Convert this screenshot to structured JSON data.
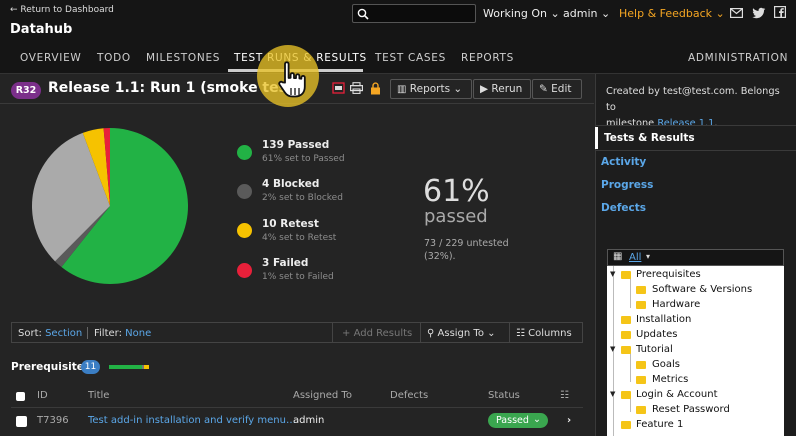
{
  "header": {
    "back_label": "← Return to Dashboard",
    "project": "Datahub",
    "working_on": "Working On",
    "user": "admin",
    "help": "Help & Feedback"
  },
  "tabs": [
    "OVERVIEW",
    "TODO",
    "MILESTONES",
    "TEST RUNS & RESULTS",
    "TEST CASES",
    "REPORTS",
    "ADMINISTRATION"
  ],
  "run": {
    "badge": "R32",
    "title": "Release 1.1: Run 1 (smoke test)",
    "reports_label": "Reports",
    "rerun_label": "Rerun",
    "edit_label": "Edit"
  },
  "legend": [
    {
      "title": "139 Passed",
      "sub": "61% set to Passed",
      "color": "#22b245"
    },
    {
      "title": "4 Blocked",
      "sub": "2% set to Blocked",
      "color": "#5a5a5a"
    },
    {
      "title": "10 Retest",
      "sub": "4% set to Retest",
      "color": "#f6c200"
    },
    {
      "title": "3 Failed",
      "sub": "1% set to Failed",
      "color": "#e8203a"
    }
  ],
  "summary": {
    "percent": "61%",
    "passed_label": "passed",
    "untested_line1": "73 / 229 untested",
    "untested_line2": "(32%)."
  },
  "chart_data": {
    "type": "pie",
    "slices": [
      {
        "label": "Passed",
        "value": 139,
        "color": "#22b245"
      },
      {
        "label": "Blocked",
        "value": 4,
        "color": "#5a5a5a"
      },
      {
        "label": "Untested",
        "value": 73,
        "color": "#aaaaaa"
      },
      {
        "label": "Retest",
        "value": 10,
        "color": "#f6c200"
      },
      {
        "label": "Failed",
        "value": 3,
        "color": "#e8203a"
      }
    ]
  },
  "filters": {
    "sort_label": "Sort:",
    "sort_value": "Section",
    "filter_label": "Filter:",
    "filter_value": "None",
    "add_results": "Add Results",
    "assign_to": "Assign To",
    "columns": "Columns"
  },
  "section": {
    "name": "Prerequisites",
    "count": "11",
    "progress": {
      "passed": 0.82,
      "blocked": 0.05,
      "retest": 0.13
    }
  },
  "table": {
    "headers": {
      "id": "ID",
      "title": "Title",
      "assigned": "Assigned To",
      "defects": "Defects",
      "status": "Status"
    },
    "row": {
      "id": "T7396",
      "title": "Test add-in installation and verify menu…",
      "assigned": "admin",
      "defects": "",
      "status": "Passed"
    }
  },
  "sidebar": {
    "info_line1": "Created by test@test.com. Belongs to",
    "info_line2": "milestone",
    "milestone_link": "Release 1.1",
    "info_end": ".",
    "nav": [
      "Tests & Results",
      "Activity",
      "Progress",
      "Defects"
    ],
    "tree_filter": "All",
    "tree": [
      "Prerequisites",
      "Software & Versions",
      "Hardware",
      "Installation",
      "Updates",
      "Tutorial",
      "Goals",
      "Metrics",
      "Login & Account",
      "Reset Password",
      "Feature 1"
    ]
  },
  "colors": {
    "accent": "#f5a623",
    "link": "#5ba7e8",
    "badge": "#7b2f8a",
    "passed": "#3aa64f"
  }
}
